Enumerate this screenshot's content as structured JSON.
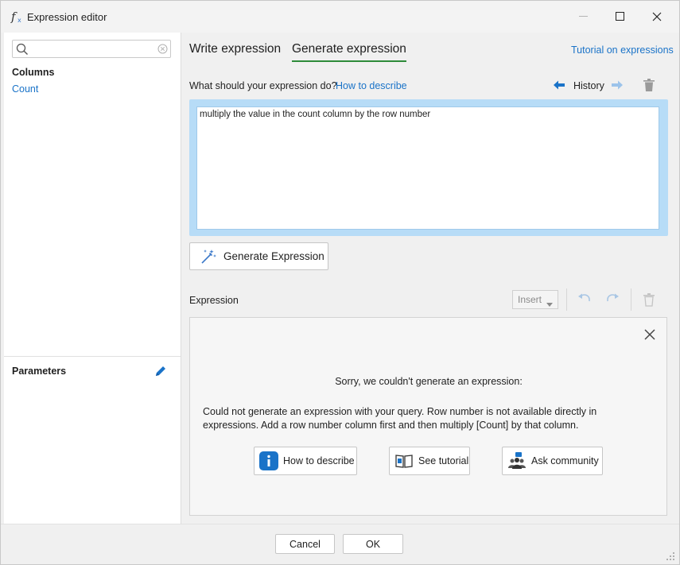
{
  "window": {
    "title": "Expression editor",
    "icon": "fx-icon"
  },
  "sidebar": {
    "search": {
      "placeholder": "",
      "value": ""
    },
    "columns_heading": "Columns",
    "columns": [
      {
        "label": "Count"
      }
    ],
    "parameters_heading": "Parameters"
  },
  "tabs": [
    {
      "label": "Write expression",
      "active": false
    },
    {
      "label": "Generate expression",
      "active": true
    }
  ],
  "tutorial_link": "Tutorial on expressions",
  "prompt": {
    "label": "What should your expression do?",
    "how_link": "How to describe",
    "history_label": "History",
    "value": "multiply the value in the count column by the row number"
  },
  "generate_button": "Generate Expression",
  "expression": {
    "label": "Expression",
    "insert_label": "Insert"
  },
  "result": {
    "heading": "Sorry, we couldn't generate an expression:",
    "message": "Could not generate an expression with your query. Row number is not available directly in expressions. Add a row number column first and then multiply [Count] by that column.",
    "actions": [
      {
        "label": "How to describe",
        "icon": "info-icon"
      },
      {
        "label": "See tutorial",
        "icon": "book-icon"
      },
      {
        "label": "Ask community",
        "icon": "community-icon"
      }
    ]
  },
  "footer": {
    "cancel": "Cancel",
    "ok": "OK"
  },
  "colors": {
    "accent_link": "#1a73c8",
    "tab_underline": "#2e8b3a",
    "prompt_highlight": "#b7dcf7"
  }
}
